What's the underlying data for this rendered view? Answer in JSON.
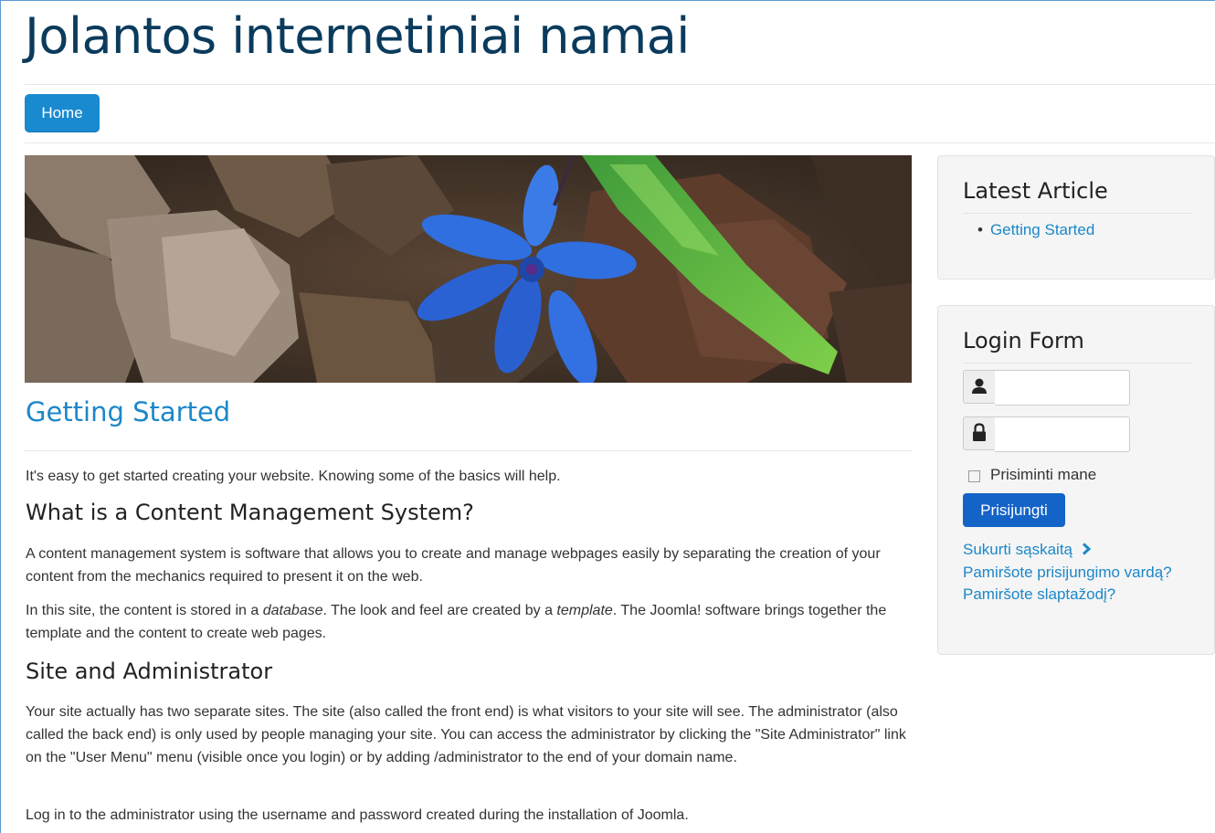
{
  "site": {
    "title": "Jolantos internetiniai namai"
  },
  "nav": {
    "home_label": "Home"
  },
  "article": {
    "title": "Getting Started",
    "intro": "It's easy to get started creating your website. Knowing some of the basics will help.",
    "h_cms": "What is a Content Management System?",
    "p_cms": "A content management system is software that allows you to create and manage webpages easily by separating the creation of your content from the mechanics required to present it on the web.",
    "p_db_1": "In this site, the content is stored in a ",
    "p_db_em1": "database",
    "p_db_2": ". The look and feel are created by a ",
    "p_db_em2": "template",
    "p_db_3": ". The Joomla! software brings together the template and the content to create web pages.",
    "h_site": "Site and Administrator",
    "p_site": "Your site actually has two separate sites. The site (also called the front end) is what visitors to your site will see. The administrator (also called the back end) is only used by people managing your site. You can access the administrator by clicking the \"Site Administrator\" link on the \"User Menu\" menu (visible once you login) or by adding /administrator to the end of your domain name.",
    "p_login": "Log in to the administrator using the username and password created during the installation of Joomla."
  },
  "latest": {
    "title": "Latest Article",
    "items": [
      "Getting Started"
    ]
  },
  "login": {
    "title": "Login Form",
    "username_value": "",
    "password_value": "",
    "remember_label": "Prisiminti mane",
    "submit_label": "Prisijungti",
    "create_account": "Sukurti sąskaitą",
    "forgot_username": "Pamiršote prisijungimo vardą?",
    "forgot_password": "Pamiršote slaptažodį?"
  },
  "colors": {
    "title": "#0b3b5c",
    "accent": "#1c87c9",
    "button": "#1464c8"
  },
  "icons": {
    "username": "user-icon",
    "password": "lock-icon",
    "create_account": "chevron-right-icon"
  }
}
